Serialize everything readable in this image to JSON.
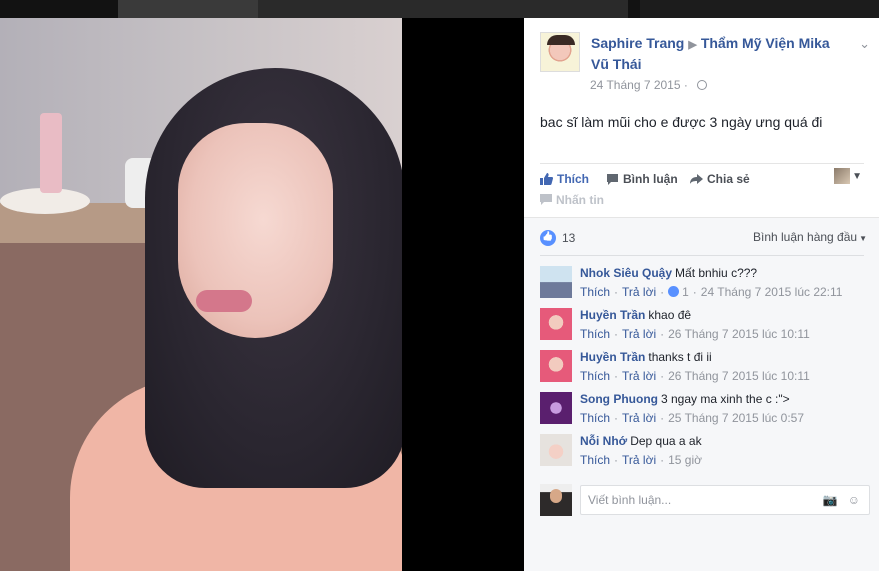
{
  "post": {
    "author": "Saphire Trang",
    "target_page": "Thẩm Mỹ Viện Mika Vũ Thái",
    "timestamp": "24 Tháng 7 2015",
    "text": "bac sĩ làm mũi cho e được 3 ngày ưng quá đi"
  },
  "actions": {
    "like": "Thích",
    "comment": "Bình luận",
    "share": "Chia sẻ",
    "unfollow": "Nhấn tin"
  },
  "reactions": {
    "count": "13",
    "sort_label": "Bình luận hàng đầu"
  },
  "comments": [
    {
      "name": "Nhok Siêu Quậy",
      "text": "Mất bnhiu c???",
      "like": "Thích",
      "reply": "Trả lời",
      "likes": "1",
      "time": "24 Tháng 7 2015 lúc 22:11"
    },
    {
      "name": "Huyền Trần",
      "text": "khao đê",
      "like": "Thích",
      "reply": "Trả lời",
      "time": "26 Tháng 7 2015 lúc 10:11"
    },
    {
      "name": "Huyền Trần",
      "text": "thanks t đi ii",
      "like": "Thích",
      "reply": "Trả lời",
      "time": "26 Tháng 7 2015 lúc 10:11"
    },
    {
      "name": "Song Phuong",
      "text": "3 ngay ma xinh the c :\">",
      "like": "Thích",
      "reply": "Trả lời",
      "time": "25 Tháng 7 2015 lúc 0:57"
    },
    {
      "name": "Nỗi Nhớ",
      "text": "Dep qua a ak",
      "like": "Thích",
      "reply": "Trả lời",
      "time": "15 giờ"
    }
  ],
  "reply": {
    "placeholder": "Viết bình luận..."
  },
  "colors": {
    "link": "#365899",
    "like_blue": "#4267b2",
    "meta_gray": "#90949c"
  }
}
